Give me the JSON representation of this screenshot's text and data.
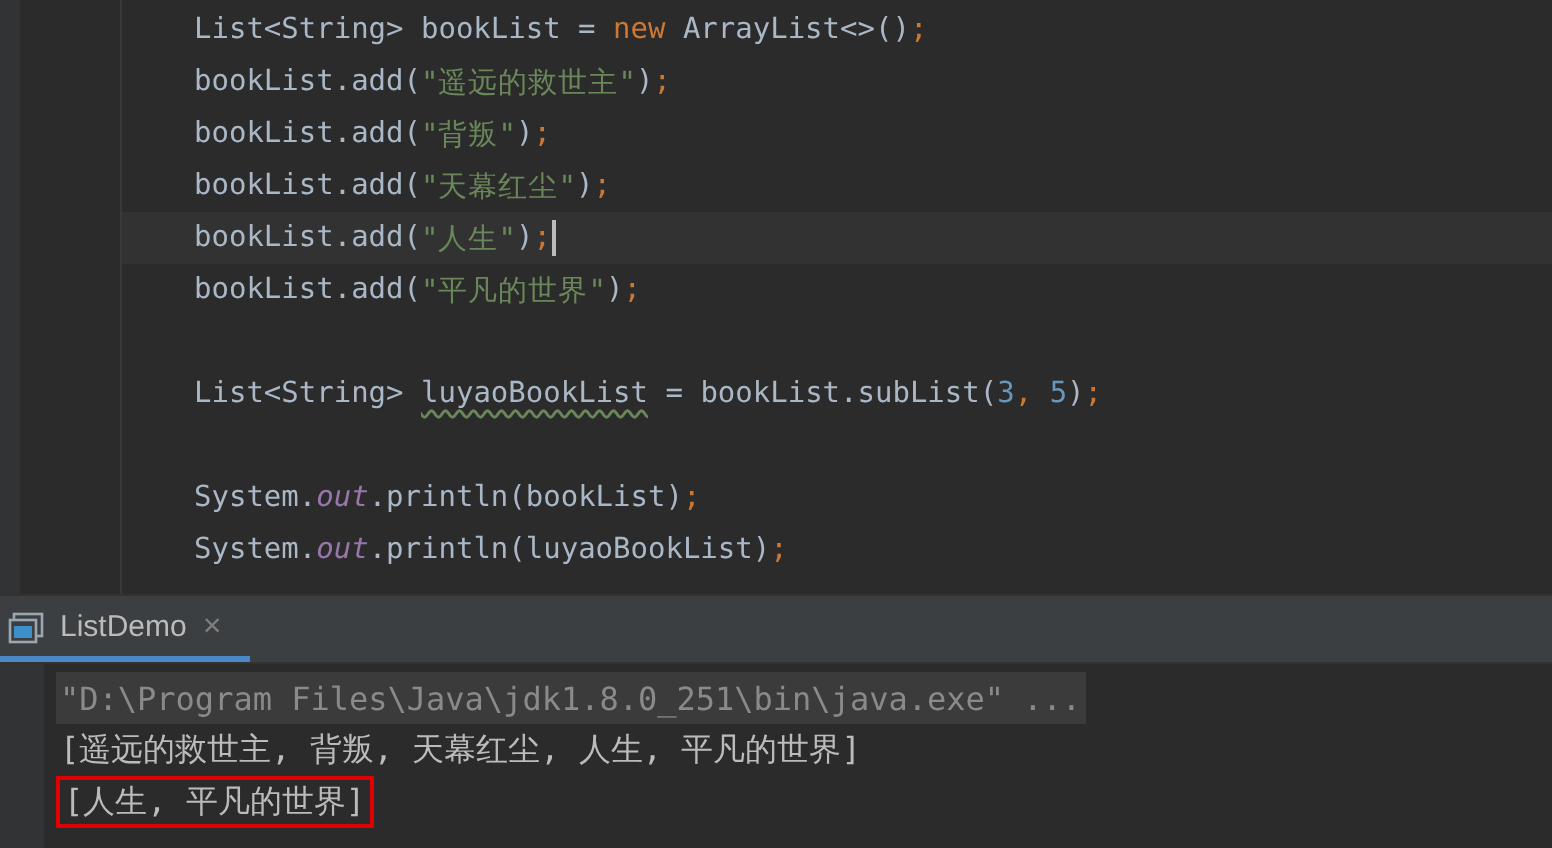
{
  "editor": {
    "lines": [
      {
        "current": false,
        "tokens": [
          {
            "kind": "plain",
            "text": "List<String> bookList = "
          },
          {
            "kind": "keyword",
            "text": "new"
          },
          {
            "kind": "plain",
            "text": " ArrayList<>()"
          },
          {
            "kind": "punct",
            "text": ";"
          }
        ]
      },
      {
        "current": false,
        "tokens": [
          {
            "kind": "plain",
            "text": "bookList.add("
          },
          {
            "kind": "string",
            "text": "\"遥远的救世主\""
          },
          {
            "kind": "plain",
            "text": ")"
          },
          {
            "kind": "punct",
            "text": ";"
          }
        ]
      },
      {
        "current": false,
        "tokens": [
          {
            "kind": "plain",
            "text": "bookList.add("
          },
          {
            "kind": "string",
            "text": "\"背叛\""
          },
          {
            "kind": "plain",
            "text": ")"
          },
          {
            "kind": "punct",
            "text": ";"
          }
        ]
      },
      {
        "current": false,
        "tokens": [
          {
            "kind": "plain",
            "text": "bookList.add("
          },
          {
            "kind": "string",
            "text": "\"天幕红尘\""
          },
          {
            "kind": "plain",
            "text": ")"
          },
          {
            "kind": "punct",
            "text": ";"
          }
        ]
      },
      {
        "current": true,
        "tokens": [
          {
            "kind": "plain",
            "text": "bookList.add("
          },
          {
            "kind": "string",
            "text": "\"人生\""
          },
          {
            "kind": "plain",
            "text": ")"
          },
          {
            "kind": "punct",
            "text": ";"
          }
        ]
      },
      {
        "current": false,
        "tokens": [
          {
            "kind": "plain",
            "text": "bookList.add("
          },
          {
            "kind": "string",
            "text": "\"平凡的世界\""
          },
          {
            "kind": "plain",
            "text": ")"
          },
          {
            "kind": "punct",
            "text": ";"
          }
        ]
      },
      {
        "current": false
      },
      {
        "current": false,
        "tokens": [
          {
            "kind": "plain",
            "text": "List<String> "
          },
          {
            "kind": "warning",
            "text": "luyaoBookList"
          },
          {
            "kind": "plain",
            "text": " = bookList.subList("
          },
          {
            "kind": "number",
            "text": "3"
          },
          {
            "kind": "punct",
            "text": ", "
          },
          {
            "kind": "number",
            "text": "5"
          },
          {
            "kind": "plain",
            "text": ")"
          },
          {
            "kind": "punct",
            "text": ";"
          }
        ]
      },
      {
        "current": false
      },
      {
        "current": false,
        "tokens": [
          {
            "kind": "plain",
            "text": "System."
          },
          {
            "kind": "static",
            "text": "out"
          },
          {
            "kind": "plain",
            "text": ".println(bookList)"
          },
          {
            "kind": "punct",
            "text": ";"
          }
        ]
      },
      {
        "current": false,
        "tokens": [
          {
            "kind": "plain",
            "text": "System."
          },
          {
            "kind": "static",
            "text": "out"
          },
          {
            "kind": "plain",
            "text": ".println(luyaoBookList)"
          },
          {
            "kind": "punct",
            "text": ";"
          }
        ]
      }
    ]
  },
  "run_panel": {
    "tab": {
      "label": "ListDemo",
      "close": "×",
      "selected": true
    },
    "console": [
      {
        "kind": "command",
        "text": "\"D:\\Program Files\\Java\\jdk1.8.0_251\\bin\\java.exe\" ...",
        "boxed": false
      },
      {
        "kind": "output",
        "text": "[遥远的救世主, 背叛, 天幕红尘, 人生, 平凡的世界]",
        "boxed": false
      },
      {
        "kind": "output",
        "text": "[人生, 平凡的世界]",
        "boxed": true
      }
    ]
  }
}
